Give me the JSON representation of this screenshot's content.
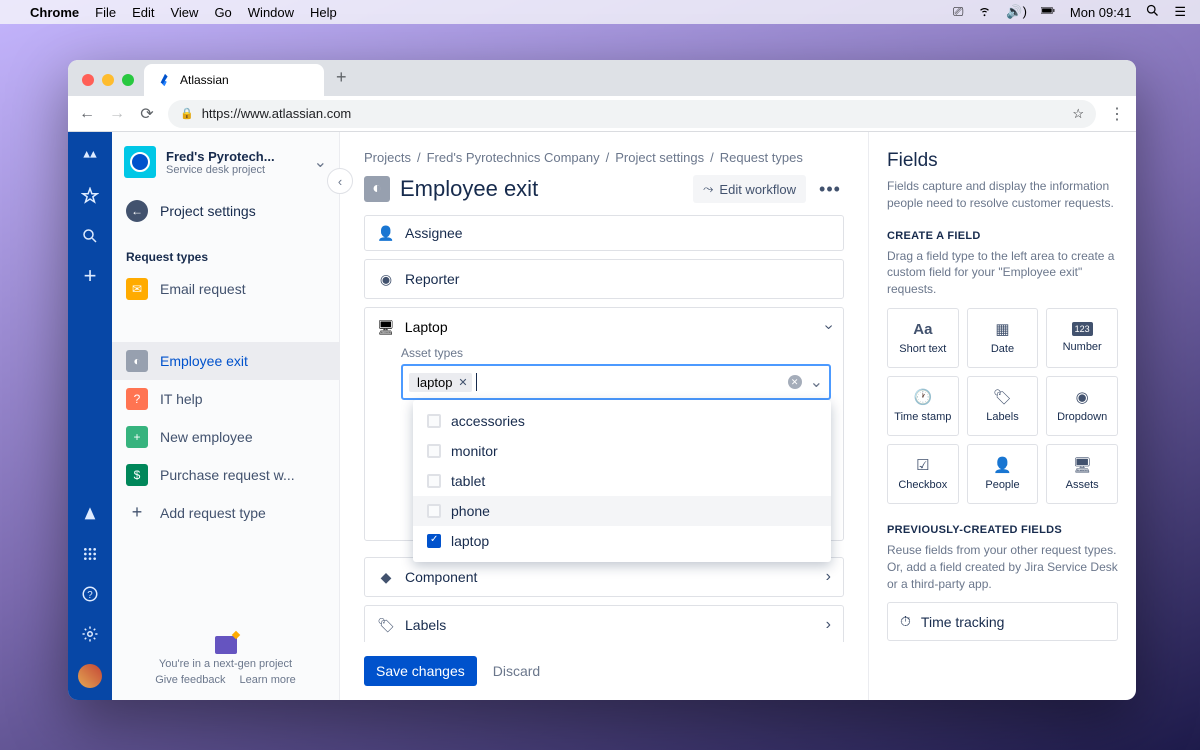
{
  "mac_menu": {
    "app": "Chrome",
    "items": [
      "File",
      "Edit",
      "View",
      "Go",
      "Window",
      "Help"
    ],
    "time": "Mon 09:41"
  },
  "tab": {
    "title": "Atlassian"
  },
  "url": "https://www.atlassian.com",
  "project": {
    "name": "Fred's Pyrotech...",
    "subtitle": "Service desk project",
    "back": "Project settings",
    "section": "Request types",
    "items": [
      {
        "label": "Email request",
        "color": "yellow"
      },
      {
        "label": "Employee exit",
        "color": "grey",
        "selected": true
      },
      {
        "label": "IT help",
        "color": "orange"
      },
      {
        "label": "New employee",
        "color": "green"
      },
      {
        "label": "Purchase request w...",
        "color": "green2"
      }
    ],
    "add": "Add request type",
    "footer": {
      "line": "You're in a next-gen project",
      "feedback": "Give feedback",
      "learn": "Learn more"
    }
  },
  "breadcrumb": [
    "Projects",
    "Fred's Pyrotechnics Company",
    "Project settings",
    "Request types"
  ],
  "page_title": "Employee exit",
  "edit_workflow": "Edit workflow",
  "fields": {
    "assignee": "Assignee",
    "reporter": "Reporter",
    "laptop": "Laptop",
    "asset_types_label": "Asset types",
    "chip": "laptop",
    "options": [
      {
        "label": "accessories",
        "checked": false
      },
      {
        "label": "monitor",
        "checked": false
      },
      {
        "label": "tablet",
        "checked": false
      },
      {
        "label": "phone",
        "checked": false,
        "hover": true
      },
      {
        "label": "laptop",
        "checked": true
      }
    ],
    "component": "Component",
    "labels": "Labels"
  },
  "actions": {
    "save": "Save changes",
    "discard": "Discard"
  },
  "panel": {
    "title": "Fields",
    "desc": "Fields capture and display the information people need to resolve customer requests.",
    "create_section": "Create a field",
    "create_sub": "Drag a field type to the left area to create a custom field for your \"Employee exit\" requests.",
    "tiles": [
      {
        "label": "Short text",
        "icon": "Aa"
      },
      {
        "label": "Date",
        "icon": "📅"
      },
      {
        "label": "Number",
        "icon": "123"
      },
      {
        "label": "Time stamp",
        "icon": "🕐"
      },
      {
        "label": "Labels",
        "icon": "🏷"
      },
      {
        "label": "Dropdown",
        "icon": "▾"
      },
      {
        "label": "Checkbox",
        "icon": "☑"
      },
      {
        "label": "People",
        "icon": "👤"
      },
      {
        "label": "Assets",
        "icon": "🖥"
      }
    ],
    "prev_section": "Previously-created fields",
    "prev_sub": "Reuse fields from your other request types. Or, add a field created by Jira Service Desk or a third-party app.",
    "time_tracking": "Time tracking"
  }
}
